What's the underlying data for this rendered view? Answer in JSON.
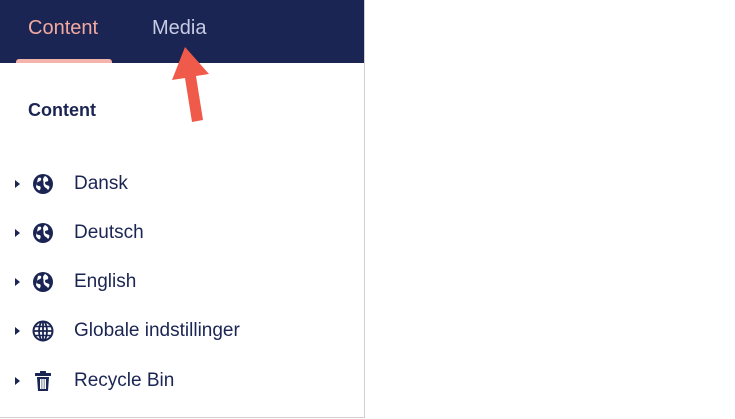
{
  "tabs": [
    {
      "label": "Content"
    },
    {
      "label": "Media"
    }
  ],
  "section": {
    "title": "Content"
  },
  "tree": [
    {
      "label": "Dansk",
      "icon": "earth-icon"
    },
    {
      "label": "Deutsch",
      "icon": "earth-icon"
    },
    {
      "label": "English",
      "icon": "earth-icon"
    },
    {
      "label": "Globale indstillinger",
      "icon": "globe-grid-icon"
    },
    {
      "label": "Recycle Bin",
      "icon": "trash-icon"
    }
  ],
  "colors": {
    "header_bg": "#1b2553",
    "active_tab": "#f3a9a0",
    "inactive_tab": "#c7cbe3",
    "text": "#1b2553",
    "annotation_arrow": "#f05a4a"
  }
}
